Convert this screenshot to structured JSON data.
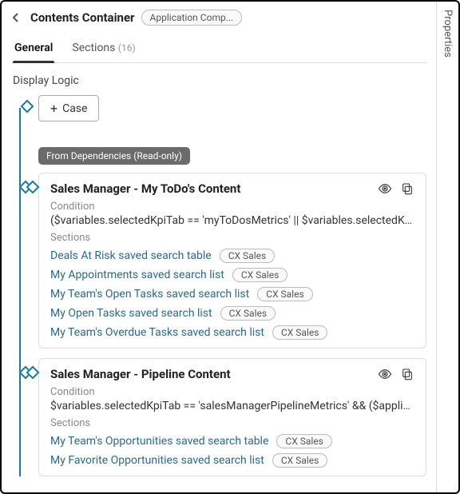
{
  "header": {
    "title": "Contents Container",
    "context_pill": "Application Comp..."
  },
  "tabs": {
    "general": "General",
    "sections": "Sections",
    "sections_count": "(16)"
  },
  "display_logic_label": "Display Logic",
  "case_button": "Case",
  "readonly_badge": "From Dependencies (Read-only)",
  "properties_tab": "Properties",
  "labels": {
    "condition": "Condition",
    "sections": "Sections"
  },
  "pill_cx": "CX Sales",
  "cards": [
    {
      "title": "Sales Manager - My ToDo's Content",
      "condition": "($variables.selectedKpiTab == 'myToDosMetrics' || $variables.selectedKpiTa...",
      "sections": [
        "Deals At Risk saved search table",
        "My Appointments saved search list",
        "My Team's Open Tasks saved search list",
        "My Open Tasks saved search list",
        "My Team's Overdue Tasks saved search list"
      ]
    },
    {
      "title": "Sales Manager - Pipeline Content",
      "condition": "$variables.selectedKpiTab == 'salesManagerPipelineMetrics' && ($applicati...",
      "sections": [
        "My Team's Opportunities saved search table",
        "My Favorite Opportunities saved search list"
      ]
    }
  ]
}
